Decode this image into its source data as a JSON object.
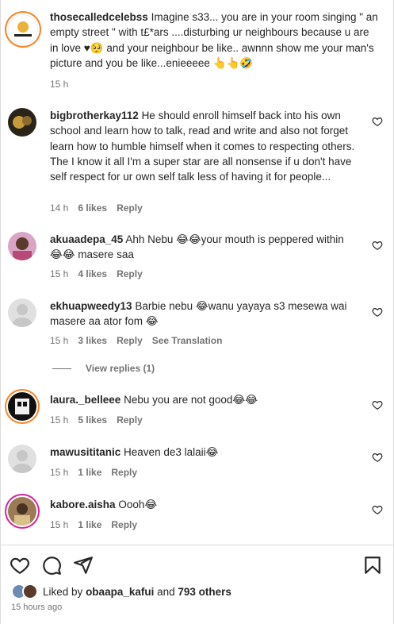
{
  "comments": [
    {
      "user": "thosecalledcelebss",
      "text": "Imagine s33... you are in your room singing \" an empty street \" with t£*ars ....disturbing ur neighbours because u are in love ♥🥺 and your neighbour be like.. awnnn show me your man's picture and you be like...enieeeee 👆👆🤣",
      "time": "15 h"
    },
    {
      "user": "bigbrotherkay112",
      "text": "He should enroll himself back into his own school and learn how to talk, read and write and also not forget learn how to humble himself when it comes to respecting others. The I know it all I'm a super star are all nonsense if u don't have self respect for ur own self talk less of having it for people...",
      "time": "14 h",
      "likes": "6 likes",
      "reply": "Reply"
    },
    {
      "user": "akuaadepa_45",
      "text": "Ahh Nebu 😂😂your mouth is peppered within 😂😂 masere saa",
      "time": "15 h",
      "likes": "4 likes",
      "reply": "Reply"
    },
    {
      "user": "ekhuapweedy13",
      "text": "Barbie nebu 😂wanu yayaya s3 mesewa wai masere aa ator fom 😂",
      "time": "15 h",
      "likes": "3 likes",
      "reply": "Reply",
      "translate": "See Translation"
    },
    {
      "user": "laura._belleee",
      "text": "Nebu you are not good😂😂",
      "time": "15 h",
      "likes": "5 likes",
      "reply": "Reply"
    },
    {
      "user": "mawusititanic",
      "text": "Heaven de3 lalaii😂",
      "time": "15 h",
      "likes": "1 like",
      "reply": "Reply"
    },
    {
      "user": "kabore.aisha",
      "text": "Oooh😂",
      "time": "15 h",
      "likes": "1 like",
      "reply": "Reply"
    }
  ],
  "view_replies": "View replies (1)",
  "liked_by": {
    "prefix": "Liked by",
    "user": "obaapa_kafui",
    "middle": "and",
    "others": "793 others"
  },
  "posted_ago": "15 hours ago",
  "icons": [
    "heart-icon",
    "comment-icon",
    "share-icon",
    "bookmark-icon"
  ],
  "colors": {
    "text": "#262626",
    "muted": "#737373",
    "divider": "#dbdbdb",
    "ring": "#d6249f"
  }
}
